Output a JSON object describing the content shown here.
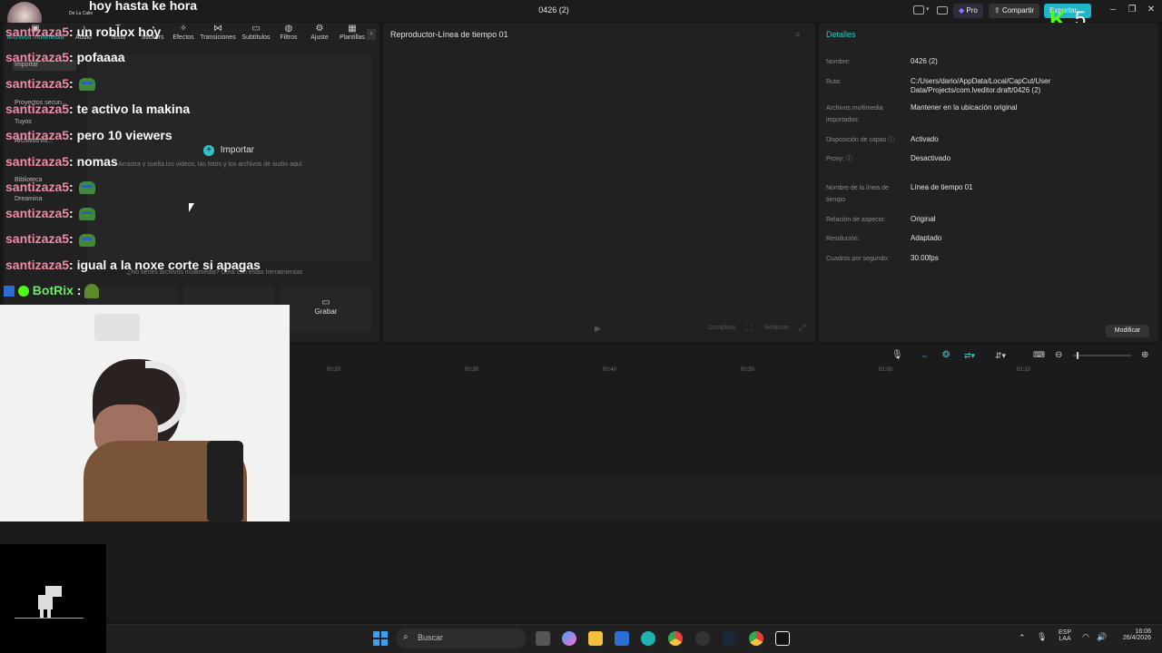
{
  "window": {
    "title": "0426 (2)"
  },
  "titlebar": {
    "pro_label": "Pro",
    "share_label": "Compartir",
    "export_label": "Exportar"
  },
  "stream": {
    "channel_label": "De La Calle",
    "badge_k": "K",
    "badge_num": "5"
  },
  "toolbar": {
    "tools": [
      {
        "icon": "media-icon",
        "glyph": "▣",
        "label": "Archivos multimedia"
      },
      {
        "icon": "audio-icon",
        "glyph": "♪",
        "label": "Audio"
      },
      {
        "icon": "text-icon",
        "glyph": "T",
        "label": "Texto"
      },
      {
        "icon": "sticker-icon",
        "glyph": "◔",
        "label": "Stickers"
      },
      {
        "icon": "effects-icon",
        "glyph": "✧",
        "label": "Efectos"
      },
      {
        "icon": "transitions-icon",
        "glyph": "⋈",
        "label": "Transiciones"
      },
      {
        "icon": "subtitles-icon",
        "glyph": "▭",
        "label": "Subtítulos"
      },
      {
        "icon": "filters-icon",
        "glyph": "◍",
        "label": "Filtros"
      },
      {
        "icon": "adjust-icon",
        "glyph": "⚙",
        "label": "Ajuste"
      },
      {
        "icon": "templates-icon",
        "glyph": "▦",
        "label": "Plantillas"
      }
    ]
  },
  "sidebar": {
    "items": [
      "Importar",
      "Proyectos secun...",
      "Tuyos",
      "Archivos int...",
      "Biblioteca",
      "Dreamina"
    ]
  },
  "media": {
    "import_label": "Importar",
    "drop_hint": "Arrastra y suelta los videos, las fotos y los archivos de audio aquí",
    "tools_hint": "¿No tienes archivos multimedia? Crea con estas herramientas",
    "record_label": "Grabar"
  },
  "player": {
    "title": "Reproductor-Línea de tiempo 01",
    "ratio_label": "Completa",
    "ratio2_label": "Relación"
  },
  "details": {
    "header": "Detalles",
    "rows": [
      {
        "label": "Nombre:",
        "value": "0426 (2)"
      },
      {
        "label": "Ruta:",
        "value": "C:/Users/dario/AppData/Local/CapCut/User Data/Projects/com.lveditor.draft/0426 (2)"
      },
      {
        "label": "Archivos multimedia importados:",
        "value": "Mantener en la ubicación original"
      },
      {
        "label": "Disposición de capas ⓘ",
        "value": "Activado"
      },
      {
        "label": "Proxy: ⓘ",
        "value": "Desactivado"
      },
      {
        "label": "Nombre de la línea de tiempo",
        "value": "Línea de tiempo 01"
      },
      {
        "label": "Relación de aspecto:",
        "value": "Original"
      },
      {
        "label": "Resolución:",
        "value": "Adaptado"
      },
      {
        "label": "Cuadros por segundo:",
        "value": "30.00fps"
      }
    ],
    "modify_label": "Modificar"
  },
  "timeline": {
    "ticks": [
      "00:20",
      "00:30",
      "00:40",
      "00:50",
      "01:00",
      "01:10"
    ]
  },
  "chat": [
    {
      "user": "",
      "text": "hoy hasta ke hora",
      "emote": false
    },
    {
      "user": "santizaza5",
      "text": ": un roblox hoy",
      "emote": false
    },
    {
      "user": "santizaza5",
      "text": ": pofaaaa",
      "emote": false
    },
    {
      "user": "santizaza5",
      "text": ":",
      "emote": true
    },
    {
      "user": "santizaza5",
      "text": ": te activo la makina",
      "emote": false
    },
    {
      "user": "santizaza5",
      "text": ": pero 10 viewers",
      "emote": false
    },
    {
      "user": "santizaza5",
      "text": ": nomas",
      "emote": false
    },
    {
      "user": "santizaza5",
      "text": ":",
      "emote": true
    },
    {
      "user": "santizaza5",
      "text": ":",
      "emote": true
    },
    {
      "user": "santizaza5",
      "text": ":",
      "emote": true
    },
    {
      "user": "santizaza5",
      "text": ": igual a la noxe corte si apagas",
      "emote": false
    }
  ],
  "bot": {
    "user": "BotRix",
    "text": ":"
  },
  "taskbar": {
    "search_placeholder": "Buscar",
    "lang_top": "ESP",
    "lang_bottom": "LAA",
    "time": "16:06",
    "date": "26/4/2026"
  },
  "colors": {
    "accent": "#27c7c7",
    "chat_user": "#f08ca6",
    "bot": "#6ee86a"
  }
}
